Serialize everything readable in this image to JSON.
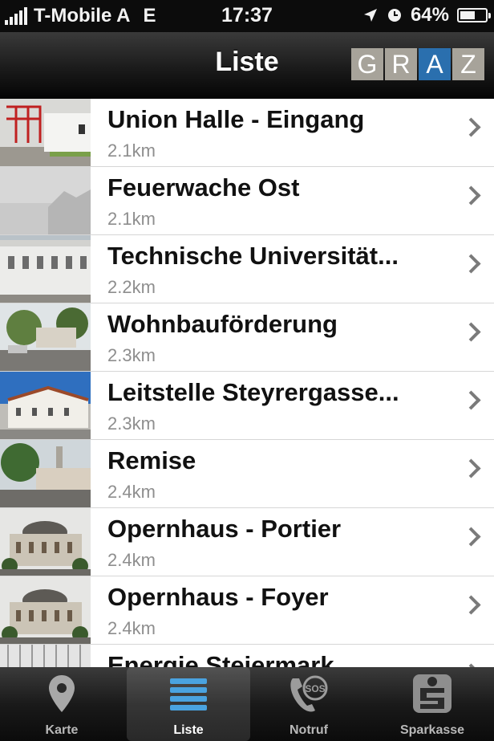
{
  "status": {
    "carrier": "T-Mobile A",
    "network": "E",
    "time": "17:37",
    "battery": "64%",
    "battery_level": 0.64
  },
  "nav": {
    "title": "Liste",
    "logo_letters": [
      "G",
      "R",
      "A",
      "Z"
    ]
  },
  "items": [
    {
      "name": "Union Halle - Eingang",
      "distance": "2.1km"
    },
    {
      "name": "Feuerwache Ost",
      "distance": "2.1km"
    },
    {
      "name": "Technische Universität...",
      "distance": "2.2km"
    },
    {
      "name": "Wohnbauförderung",
      "distance": "2.3km"
    },
    {
      "name": "Leitstelle Steyrergasse...",
      "distance": "2.3km"
    },
    {
      "name": "Remise",
      "distance": "2.4km"
    },
    {
      "name": "Opernhaus - Portier",
      "distance": "2.4km"
    },
    {
      "name": "Opernhaus - Foyer",
      "distance": "2.4km"
    },
    {
      "name": "Energie Steiermark",
      "distance": ""
    }
  ],
  "tabs": [
    {
      "label": "Karte",
      "icon": "map-pin-icon"
    },
    {
      "label": "Liste",
      "icon": "list-icon",
      "active": true
    },
    {
      "label": "Notruf",
      "icon": "sos-phone-icon"
    },
    {
      "label": "Sparkasse",
      "icon": "sparkasse-logo-icon"
    }
  ],
  "colors": {
    "logo_accent": "#2a6fae",
    "logo_tile": "#a7a39a",
    "tab_active_icon": "#4aa3e0"
  }
}
